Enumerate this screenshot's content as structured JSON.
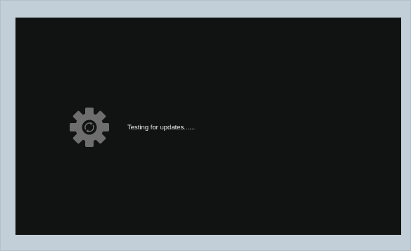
{
  "screen": {
    "status_text": "Testing for updates......",
    "icon": "gear-sync-icon",
    "colors": {
      "frame": "#c3cfd8",
      "screen": "#111312",
      "gear": "#6e6e6e",
      "text": "#f2f2f2"
    }
  }
}
